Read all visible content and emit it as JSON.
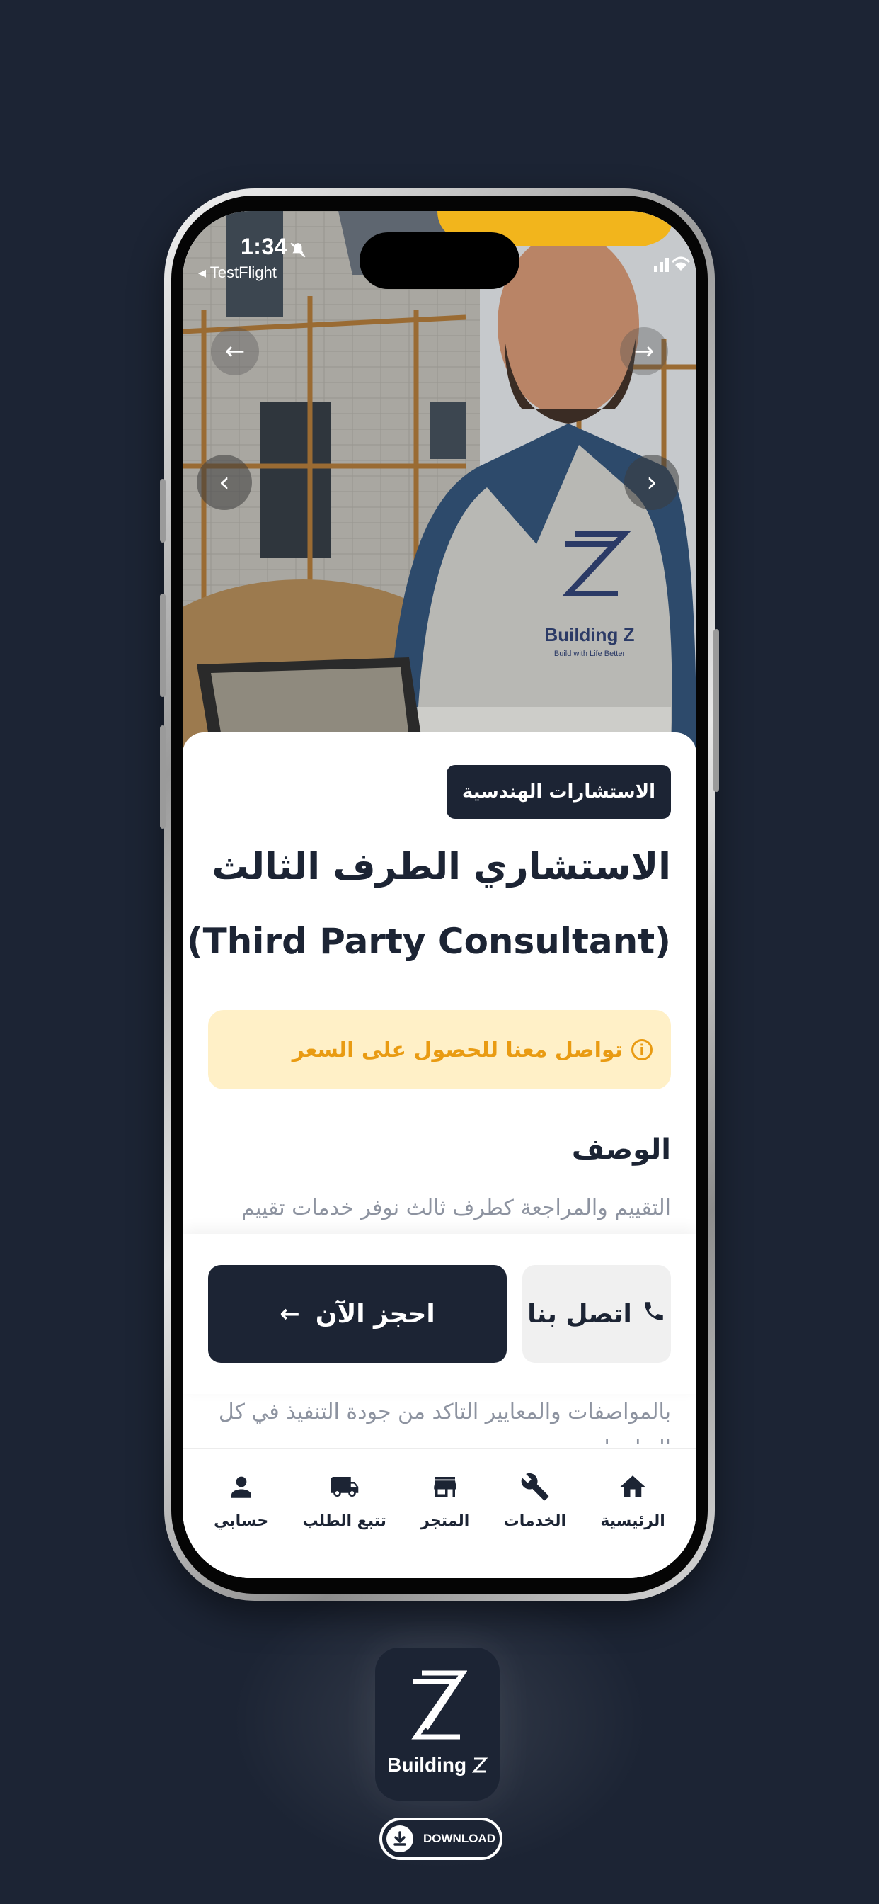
{
  "status_bar": {
    "time": "1:34",
    "back_app": "◂ TestFlight"
  },
  "hero": {
    "vest_brand": "Building Z",
    "vest_tagline": "Build with Life Better"
  },
  "service": {
    "category": "الاستشارات الهندسية",
    "title_ar": "الاستشاري الطرف الثالث",
    "title_en": "(Third Party Consultant)",
    "price_note": "تواصل معنا للحصول على السعر",
    "description_heading": "الوصف",
    "description_line1": "التقييم والمراجعة كطرف ثالث نوفر خدمات تقييم",
    "description_line2": "بالمواصفات والمعايير التاكد من جودة التنفيذ في كل",
    "description_line3": "التفاصيل"
  },
  "actions": {
    "book_label": "احجز الآن",
    "call_label": "اتصل بنا"
  },
  "bottom_nav": {
    "home": "الرئيسية",
    "services": "الخدمات",
    "store": "المتجر",
    "track_order": "تتبع الطلب",
    "account": "حسابي"
  },
  "branding": {
    "logo_text": "Building",
    "download_label": "DOWNLOAD"
  },
  "colors": {
    "navy": "#1c2434",
    "price_bg": "#fff0c7",
    "price_text": "#e99b12"
  }
}
